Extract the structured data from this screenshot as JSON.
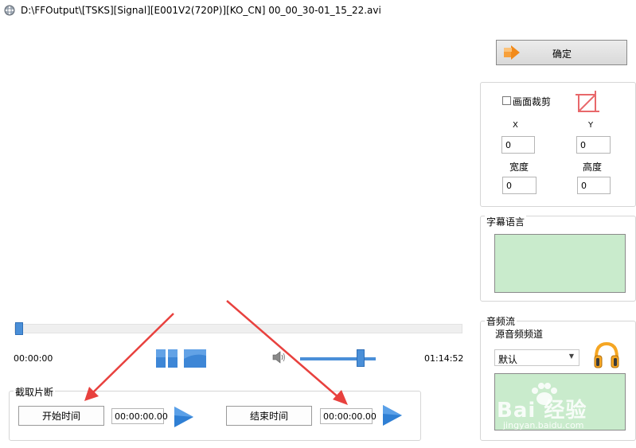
{
  "window": {
    "title": "D:\\FFOutput\\[TSKS][Signal][E001V2(720P)][KO_CN] 00_00_30-01_15_22.avi"
  },
  "player": {
    "current_time": "00:00:00",
    "total_time": "01:14:52",
    "seek_position": 0.0,
    "volume_level": 0.78
  },
  "clip": {
    "legend": "截取片断",
    "start_button": "开始时间",
    "start_value": "00:00:00.00",
    "end_button": "结束时间",
    "end_value": "00:00:00.00"
  },
  "confirm": {
    "label": "确定"
  },
  "crop": {
    "checkbox_label": "画面裁剪",
    "checked": false,
    "x_label": "X",
    "y_label": "Y",
    "x_value": "0",
    "y_value": "0",
    "width_label": "宽度",
    "height_label": "高度",
    "width_value": "0",
    "height_value": "0"
  },
  "subtitle": {
    "legend": "字幕语言"
  },
  "audio": {
    "legend": "音频流",
    "channel_label": "源音频频道",
    "channel_selected": "默认"
  },
  "watermark": {
    "brand": "Bai  经验",
    "url": "jingyan.baidu.com"
  },
  "colors": {
    "accent_blue": "#4a8fd8",
    "list_green": "#c9ebcc",
    "arrow_red": "#e8413e"
  },
  "icons": {
    "app": "film-reel-icon",
    "pause": "pause-icon",
    "stop": "stop-icon",
    "speaker": "speaker-icon",
    "play": "play-triangle-icon",
    "confirm": "orange-arrow-icon",
    "crop": "crop-icon",
    "headphone": "headphone-icon"
  }
}
